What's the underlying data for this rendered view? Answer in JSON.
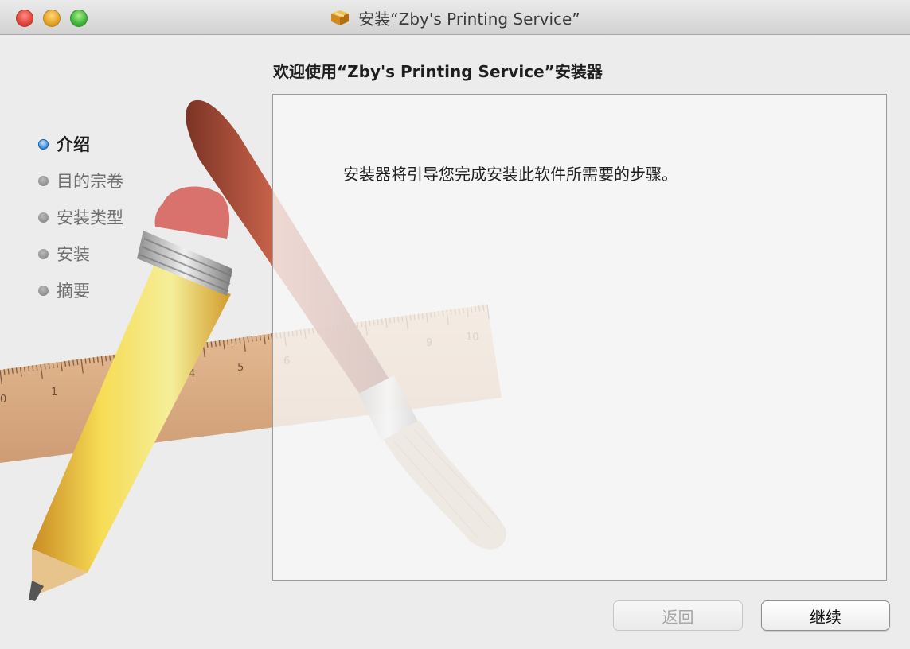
{
  "window": {
    "title": "安装“Zby's Printing Service”"
  },
  "heading": "欢迎使用“Zby's Printing Service”安装器",
  "sidebar": {
    "steps": [
      {
        "label": "介绍",
        "active": true
      },
      {
        "label": "目的宗卷",
        "active": false
      },
      {
        "label": "安装类型",
        "active": false
      },
      {
        "label": "安装",
        "active": false
      },
      {
        "label": "摘要",
        "active": false
      }
    ]
  },
  "panel": {
    "text": "安装器将引导您完成安装此软件所需要的步骤。"
  },
  "ruler": {
    "tick_labels": [
      "0",
      "1",
      "4",
      "5",
      "6",
      "9",
      "10"
    ]
  },
  "buttons": {
    "back": {
      "label": "返回",
      "enabled": false
    },
    "continue": {
      "label": "继续",
      "enabled": true
    }
  },
  "icons": [
    "close-icon",
    "minimize-icon",
    "zoom-icon",
    "package-icon",
    "step-bullet-icon"
  ],
  "colors": {
    "active_step_bullet": "#3b8de0",
    "inactive_step_bullet": "#8a8a8a",
    "close": "#e0443a",
    "minimize": "#e5a225",
    "zoom": "#3fb63a"
  }
}
